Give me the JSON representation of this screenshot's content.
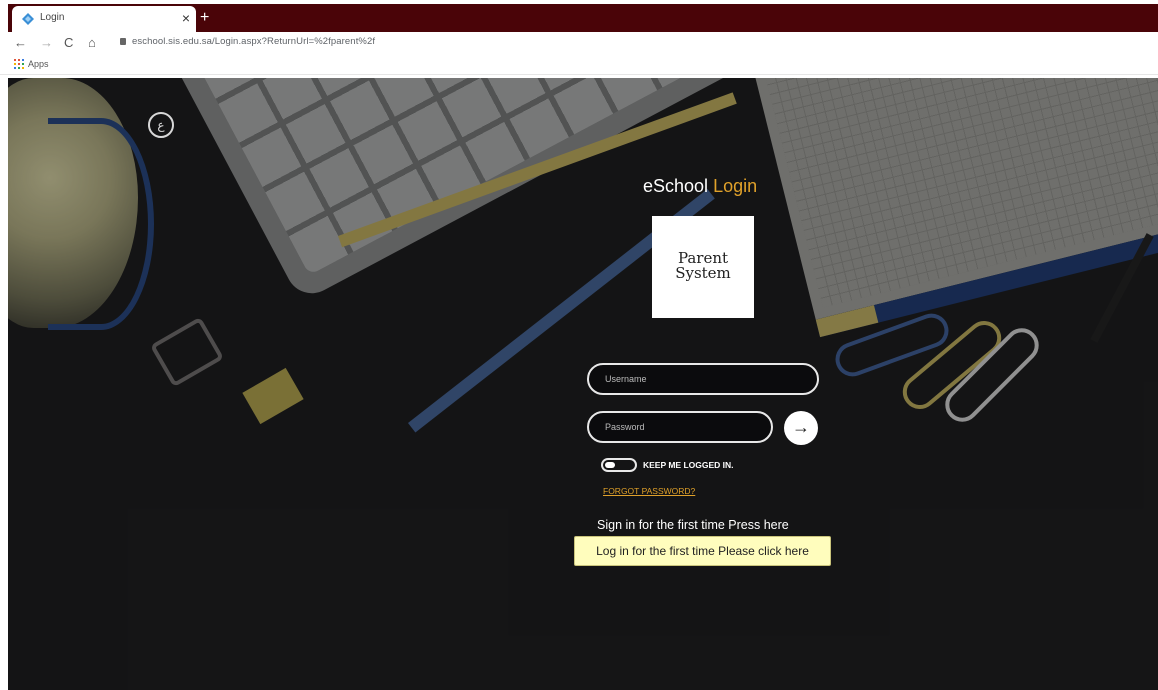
{
  "browser": {
    "tab_title": "Login",
    "tab_close": "×",
    "new_tab": "+",
    "nav": {
      "back": "←",
      "forward": "→",
      "reload": "C",
      "home": "⌂"
    },
    "url": "eschool.sis.edu.sa/Login.aspx?ReturnUrl=%2fparent%2f",
    "bookmarks": {
      "apps_label": "Apps"
    }
  },
  "page": {
    "brand_glyph": "ع",
    "title_main": "eSchool ",
    "title_accent": "Login",
    "accent_color": "#e0a12a",
    "logo_line1": "Parent",
    "logo_line2": "System",
    "username_placeholder": "Username",
    "password_placeholder": "Password",
    "submit_icon": "→",
    "keep_logged_in_label": "KEEP ME LOGGED IN.",
    "forgot_password": "FORGOT PASSWORD?",
    "first_time_text": "Sign in for the first time Press here",
    "first_time_button": "Log in for the first time Please click here"
  }
}
